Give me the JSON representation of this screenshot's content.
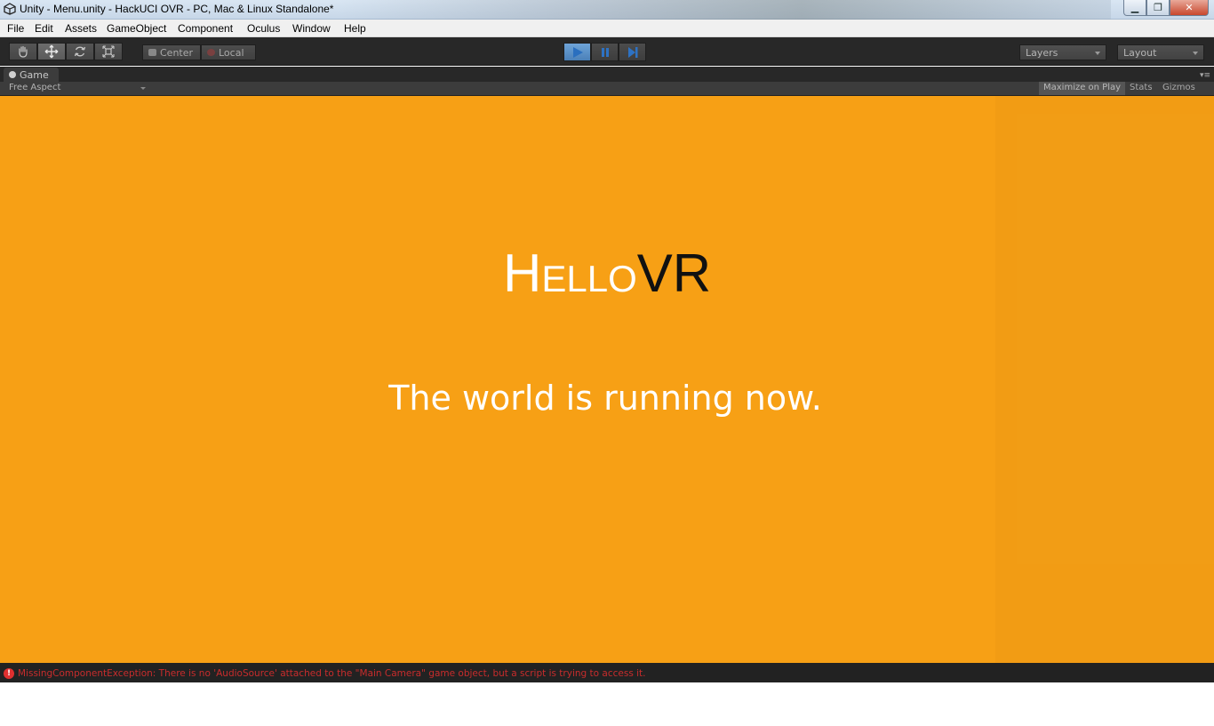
{
  "window": {
    "title": "Unity - Menu.unity - HackUCI OVR - PC, Mac & Linux Standalone*",
    "app_icon": "unity-icon",
    "controls": [
      "minimize-icon",
      "maximize-icon",
      "close-icon"
    ]
  },
  "menu": {
    "items": [
      "File",
      "Edit",
      "Assets",
      "GameObject",
      "Component",
      "Oculus",
      "Window",
      "Help"
    ]
  },
  "toolbar": {
    "tools": [
      "hand-icon",
      "move-icon",
      "rotate-icon",
      "scale-icon"
    ],
    "active_tool": "move-icon",
    "pivot_label": "Center",
    "space_label": "Local",
    "play_controls": [
      "play-icon",
      "pause-icon",
      "step-icon"
    ],
    "playing": true,
    "layers_label": "Layers",
    "layout_label": "Layout"
  },
  "game_tab": {
    "label": "Game",
    "aspect": "Free Aspect",
    "maximize_on_play": "Maximize on Play",
    "stats": "Stats",
    "gizmos": "Gizmos"
  },
  "game_view": {
    "background_color": "#f7a015",
    "logo": {
      "hello_first": "H",
      "hello_rest": "ELLO",
      "vr": "VR"
    },
    "message": "The world is running now."
  },
  "status": {
    "icon": "error-icon",
    "message": "MissingComponentException: There is no 'AudioSource' attached to the \"Main Camera\" game object, but a script is trying to access it."
  }
}
